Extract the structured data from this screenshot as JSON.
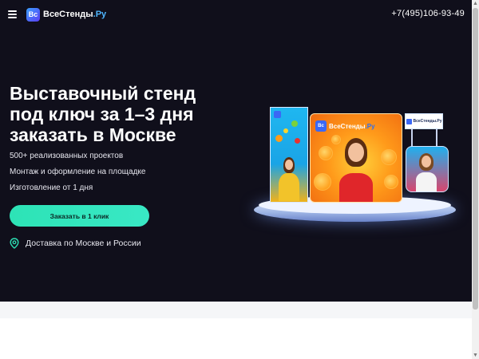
{
  "header": {
    "logo": {
      "badge": "Вс",
      "name": "ВсеСтенды",
      "tld": ".Ру"
    },
    "phone": "+7(495)106-93-49"
  },
  "hero": {
    "title_lines": [
      "Выставочный стенд",
      "под ключ за 1–3 дня",
      "заказать в Москве"
    ],
    "features": [
      "500+ реализованных проектов",
      "Монтаж и оформление на площадке",
      "Изготовление от 1 дня"
    ],
    "cta_label": "Заказать в 1 клик",
    "delivery_text": "Доставка по Москве и России"
  },
  "stand_visual": {
    "backwall_logo": {
      "badge": "Вс",
      "name": "ВсеСтенды",
      "tld": ".Ру"
    },
    "counter_logo": "ВсеСтенды.Ру"
  },
  "colors": {
    "background_dark": "#100f1b",
    "accent_cta": "#2de3b6",
    "accent_logo": "#4fb6ff"
  },
  "icons": [
    "menu-icon",
    "location-pin-icon"
  ]
}
